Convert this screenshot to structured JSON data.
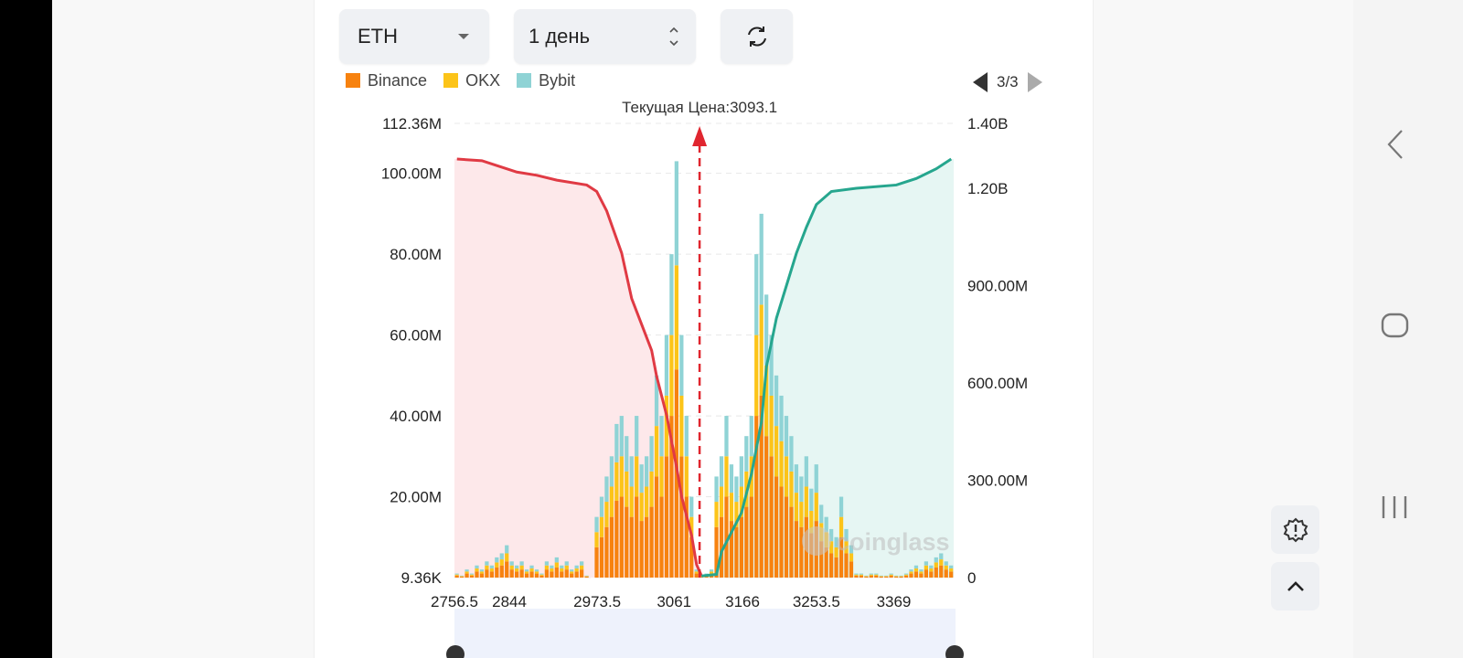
{
  "controls": {
    "coin": "ETH",
    "period": "1 день"
  },
  "pager": "3/3",
  "watermark": "coinglass",
  "colors": {
    "binance": "#f7820f",
    "okx": "#fcc419",
    "bybit": "#8fd3d5",
    "sell_line": "#e03a44",
    "buy_line": "#26a68e"
  },
  "chart_data": {
    "type": "bar",
    "title": "Текущая Цена:3093.1",
    "legend": [
      "Binance",
      "OKX",
      "Bybit"
    ],
    "legend_placement": "top-left",
    "left_axis": {
      "ticks": [
        "9.36K",
        "20.00M",
        "40.00M",
        "60.00M",
        "80.00M",
        "100.00M",
        "112.36M"
      ],
      "values": [
        0,
        20,
        40,
        60,
        80,
        100,
        112.36
      ],
      "range": [
        0,
        112.36
      ],
      "unit": "M"
    },
    "right_axis": {
      "ticks": [
        "0",
        "300.00M",
        "600.00M",
        "900.00M",
        "1.20B",
        "1.40B"
      ],
      "values": [
        0,
        300,
        600,
        900,
        1200,
        1400
      ],
      "range": [
        0,
        1400
      ],
      "unit": "M"
    },
    "x_ticks": [
      {
        "label": "2756.5",
        "bin": 0
      },
      {
        "label": "2844",
        "bin": 11
      },
      {
        "label": "2973.5",
        "bin": 28.6
      },
      {
        "label": "3061",
        "bin": 44
      },
      {
        "label": "3166",
        "bin": 57.7
      },
      {
        "label": "3253.5",
        "bin": 72.5
      },
      {
        "label": "3369",
        "bin": 88
      }
    ],
    "current_price_bin": 49.1,
    "bar_totals": [
      1,
      0.5,
      2,
      1,
      3,
      2,
      4,
      3,
      5,
      6,
      8,
      4,
      3,
      4,
      2,
      3,
      2,
      1,
      4,
      3,
      5,
      3,
      4,
      2,
      3,
      4,
      0.5,
      0,
      15,
      20,
      25,
      30,
      38,
      40,
      35,
      30,
      40,
      28,
      30,
      35,
      50,
      40,
      60,
      80,
      103,
      60,
      40,
      20,
      2,
      0.5,
      1,
      2,
      25,
      30,
      40,
      28,
      25,
      30,
      35,
      40,
      80,
      90,
      70,
      60,
      50,
      45,
      40,
      35,
      28,
      25,
      30,
      22,
      28,
      18,
      15,
      12,
      10,
      20,
      12,
      8,
      1,
      1,
      0.5,
      1,
      1,
      0.5,
      0.5,
      1,
      0.5,
      0.5,
      1,
      2,
      3,
      2,
      4,
      3,
      5,
      6,
      4,
      3
    ],
    "exchange_share": {
      "Binance": 0.5,
      "OKX": 0.25,
      "Bybit": 0.25
    },
    "sell_cumulative": [
      [
        0,
        1290
      ],
      [
        5,
        1285
      ],
      [
        8,
        1270
      ],
      [
        12,
        1250
      ],
      [
        16,
        1240
      ],
      [
        20,
        1225
      ],
      [
        26,
        1210
      ],
      [
        28,
        1190
      ],
      [
        30,
        1130
      ],
      [
        33,
        1000
      ],
      [
        35,
        860
      ],
      [
        37,
        780
      ],
      [
        39,
        700
      ],
      [
        40,
        620
      ],
      [
        42,
        500
      ],
      [
        44,
        340
      ],
      [
        45,
        250
      ],
      [
        47,
        130
      ],
      [
        48,
        40
      ],
      [
        49,
        5
      ]
    ],
    "buy_cumulative": [
      [
        49,
        5
      ],
      [
        52,
        10
      ],
      [
        53,
        80
      ],
      [
        55,
        140
      ],
      [
        57,
        200
      ],
      [
        59,
        320
      ],
      [
        61,
        480
      ],
      [
        62,
        650
      ],
      [
        64,
        800
      ],
      [
        66,
        900
      ],
      [
        68,
        1000
      ],
      [
        70,
        1080
      ],
      [
        72,
        1150
      ],
      [
        75,
        1190
      ],
      [
        80,
        1200
      ],
      [
        88,
        1210
      ],
      [
        92,
        1230
      ],
      [
        96,
        1260
      ],
      [
        99,
        1290
      ]
    ]
  }
}
